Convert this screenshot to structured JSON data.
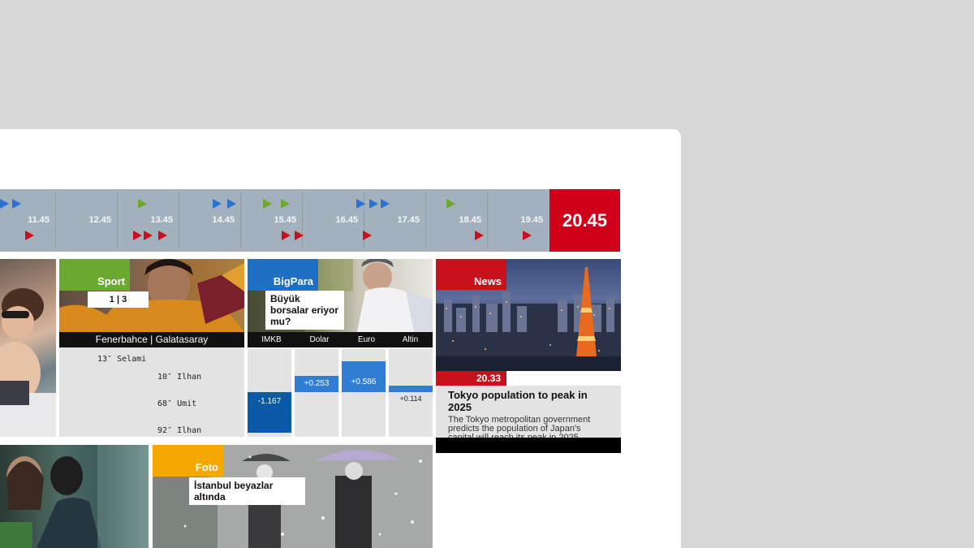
{
  "timeline": {
    "times": [
      "11.45",
      "12.45",
      "13.45",
      "14.45",
      "15.45",
      "16.45",
      "17.45",
      "18.45",
      "19.45"
    ],
    "current_time": "20.45",
    "colors": {
      "blue": "#2a73d0",
      "green": "#6aa82f",
      "red": "#c8111c",
      "current": "#d0001a"
    }
  },
  "tiles": {
    "sport": {
      "label": "Sport",
      "score": "1  |  3",
      "teams": "Fenerbahce  |  Galatasaray",
      "goals_home": [
        "13″ Selami"
      ],
      "goals_away": [
        "10″ Ilhan",
        "68″ Umit",
        "92″ Ilhan"
      ]
    },
    "bigpara": {
      "label": "BigPara",
      "headline": "Büyük borsalar eriyor mu?",
      "markets": [
        {
          "name": "IMKB",
          "change": "-1.167",
          "value": -1.167
        },
        {
          "name": "Dolar",
          "change": "+0.253",
          "value": 0.253
        },
        {
          "name": "Euro",
          "change": "+0.586",
          "value": 0.586
        },
        {
          "name": "Altin",
          "change": "+0.114",
          "value": 0.114
        }
      ]
    },
    "news": {
      "label": "News",
      "time": "20.33",
      "title": "Tokyo population to peak in 2025",
      "text": "The Tokyo metropolitan government predicts the population of Japan's capital will reach its peak in 2025."
    },
    "foto": {
      "label": "Foto",
      "caption": "İstanbul beyazlar altında"
    }
  }
}
